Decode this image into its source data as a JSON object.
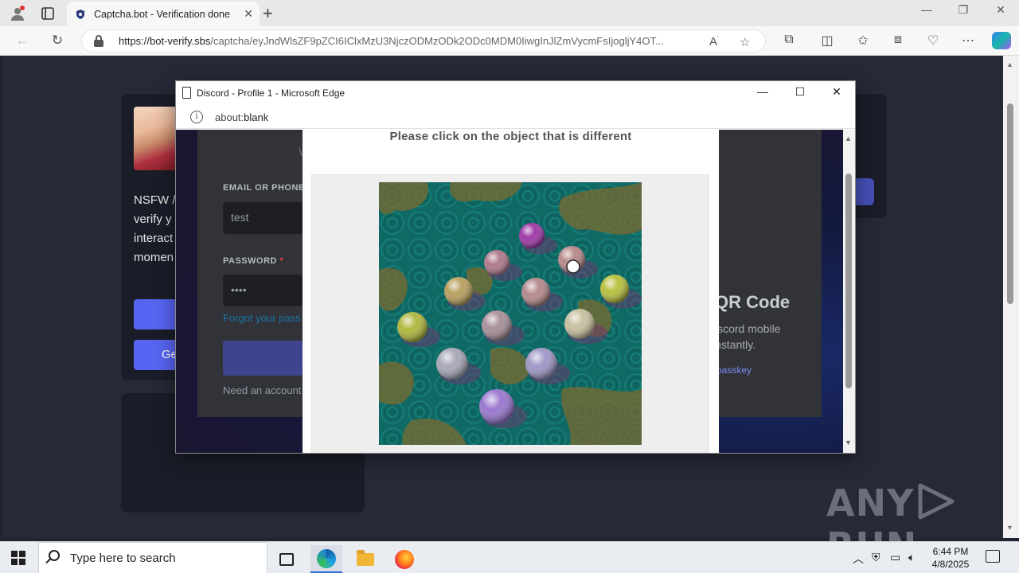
{
  "browser": {
    "tab_title": "Captcha.bot - Verification done",
    "url_host": "https://bot-verify.sbs",
    "url_path": "/captcha/eyJndWlsZF9pZCI6IClxMzU3NjczODMzODk2ODc0MDM0IiwgInJlZmVycmFsIjogljY4OT..."
  },
  "page": {
    "card_lines": [
      "NSFW /",
      "verify y",
      "interact",
      "momen"
    ],
    "button_labels": [
      "",
      "Ge"
    ]
  },
  "popup": {
    "title": "Discord - Profile 1 - Microsoft Edge",
    "url_scheme": "about:",
    "url_rest": "blank",
    "discord": {
      "heading_fragment": "W",
      "email_label": "EMAIL OR PHONE",
      "email_value": "test",
      "password_label": "PASSWORD",
      "required_mark": "*",
      "password_value": "••••",
      "forgot_link": "Forgot your pass",
      "need_account": "Need an account",
      "qr_title": "QR Code",
      "qr_line1": "iscord mobile",
      "qr_line2": "nstantly.",
      "qr_link": "passkey"
    },
    "captcha": {
      "prompt": "Please click on the object that is different",
      "spheres": [
        {
          "color": "#a03aa8"
        },
        {
          "color": "#b07a8e"
        },
        {
          "color": "#b88a8a"
        },
        {
          "color": "#b8a060"
        },
        {
          "color": "#b58a8e"
        },
        {
          "color": "#b8c040"
        },
        {
          "color": "#b0b840"
        },
        {
          "color": "#a8909a"
        },
        {
          "color": "#c8c0a0"
        },
        {
          "color": "#a8a8b8"
        },
        {
          "color": "#a098c8"
        },
        {
          "color": "#9a78d0"
        }
      ]
    }
  },
  "brand": {
    "watermark": "ANY▷RUN"
  },
  "taskbar": {
    "search_placeholder": "Type here to search",
    "time": "6:44 PM",
    "date": "4/8/2025"
  }
}
